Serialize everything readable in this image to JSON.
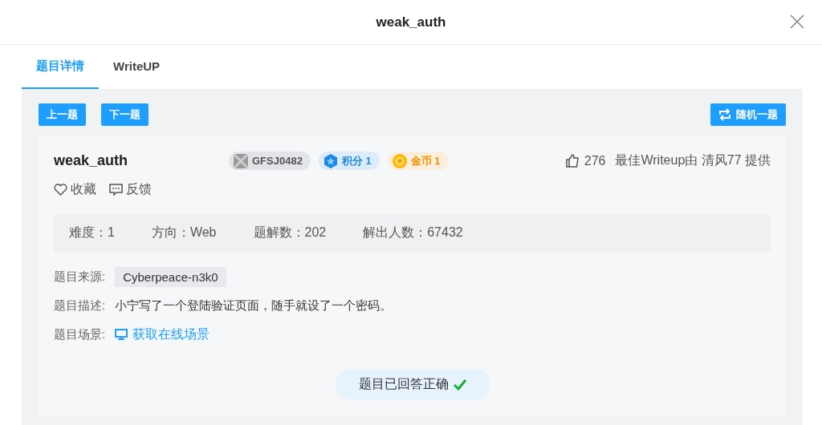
{
  "window": {
    "title": "weak_auth"
  },
  "tabs": [
    {
      "label": "题目详情",
      "selected": true
    },
    {
      "label": "WriteUP",
      "selected": false
    }
  ],
  "nav_buttons": [
    "上一题",
    "下一题"
  ],
  "random_button": "随机一题",
  "challenge": {
    "name": "weak_auth",
    "badges": [
      {
        "kind": "id",
        "label": "GFSJ0482"
      },
      {
        "kind": "points",
        "label": "积分 1"
      },
      {
        "kind": "coins",
        "label": "金币 1"
      }
    ],
    "likes": "276",
    "best_writeup": "最佳Writeup由 清风77 提供",
    "actions": [
      "收藏",
      "反馈"
    ],
    "stats": [
      "难度：1",
      "方向：Web",
      "题解数：202",
      "解出人数：67432"
    ],
    "info": [
      {
        "kind": "tag",
        "label": "题目来源:",
        "value": "Cyberpeace-n3k0"
      },
      {
        "kind": "text",
        "label": "题目描述:",
        "value": "小宁写了一个登陆验证页面，随手就设了一个密码。"
      },
      {
        "kind": "link",
        "label": "题目场景:",
        "value": "获取在线场景"
      }
    ],
    "status": {
      "text": "题目已回答正确",
      "correct": true
    }
  }
}
